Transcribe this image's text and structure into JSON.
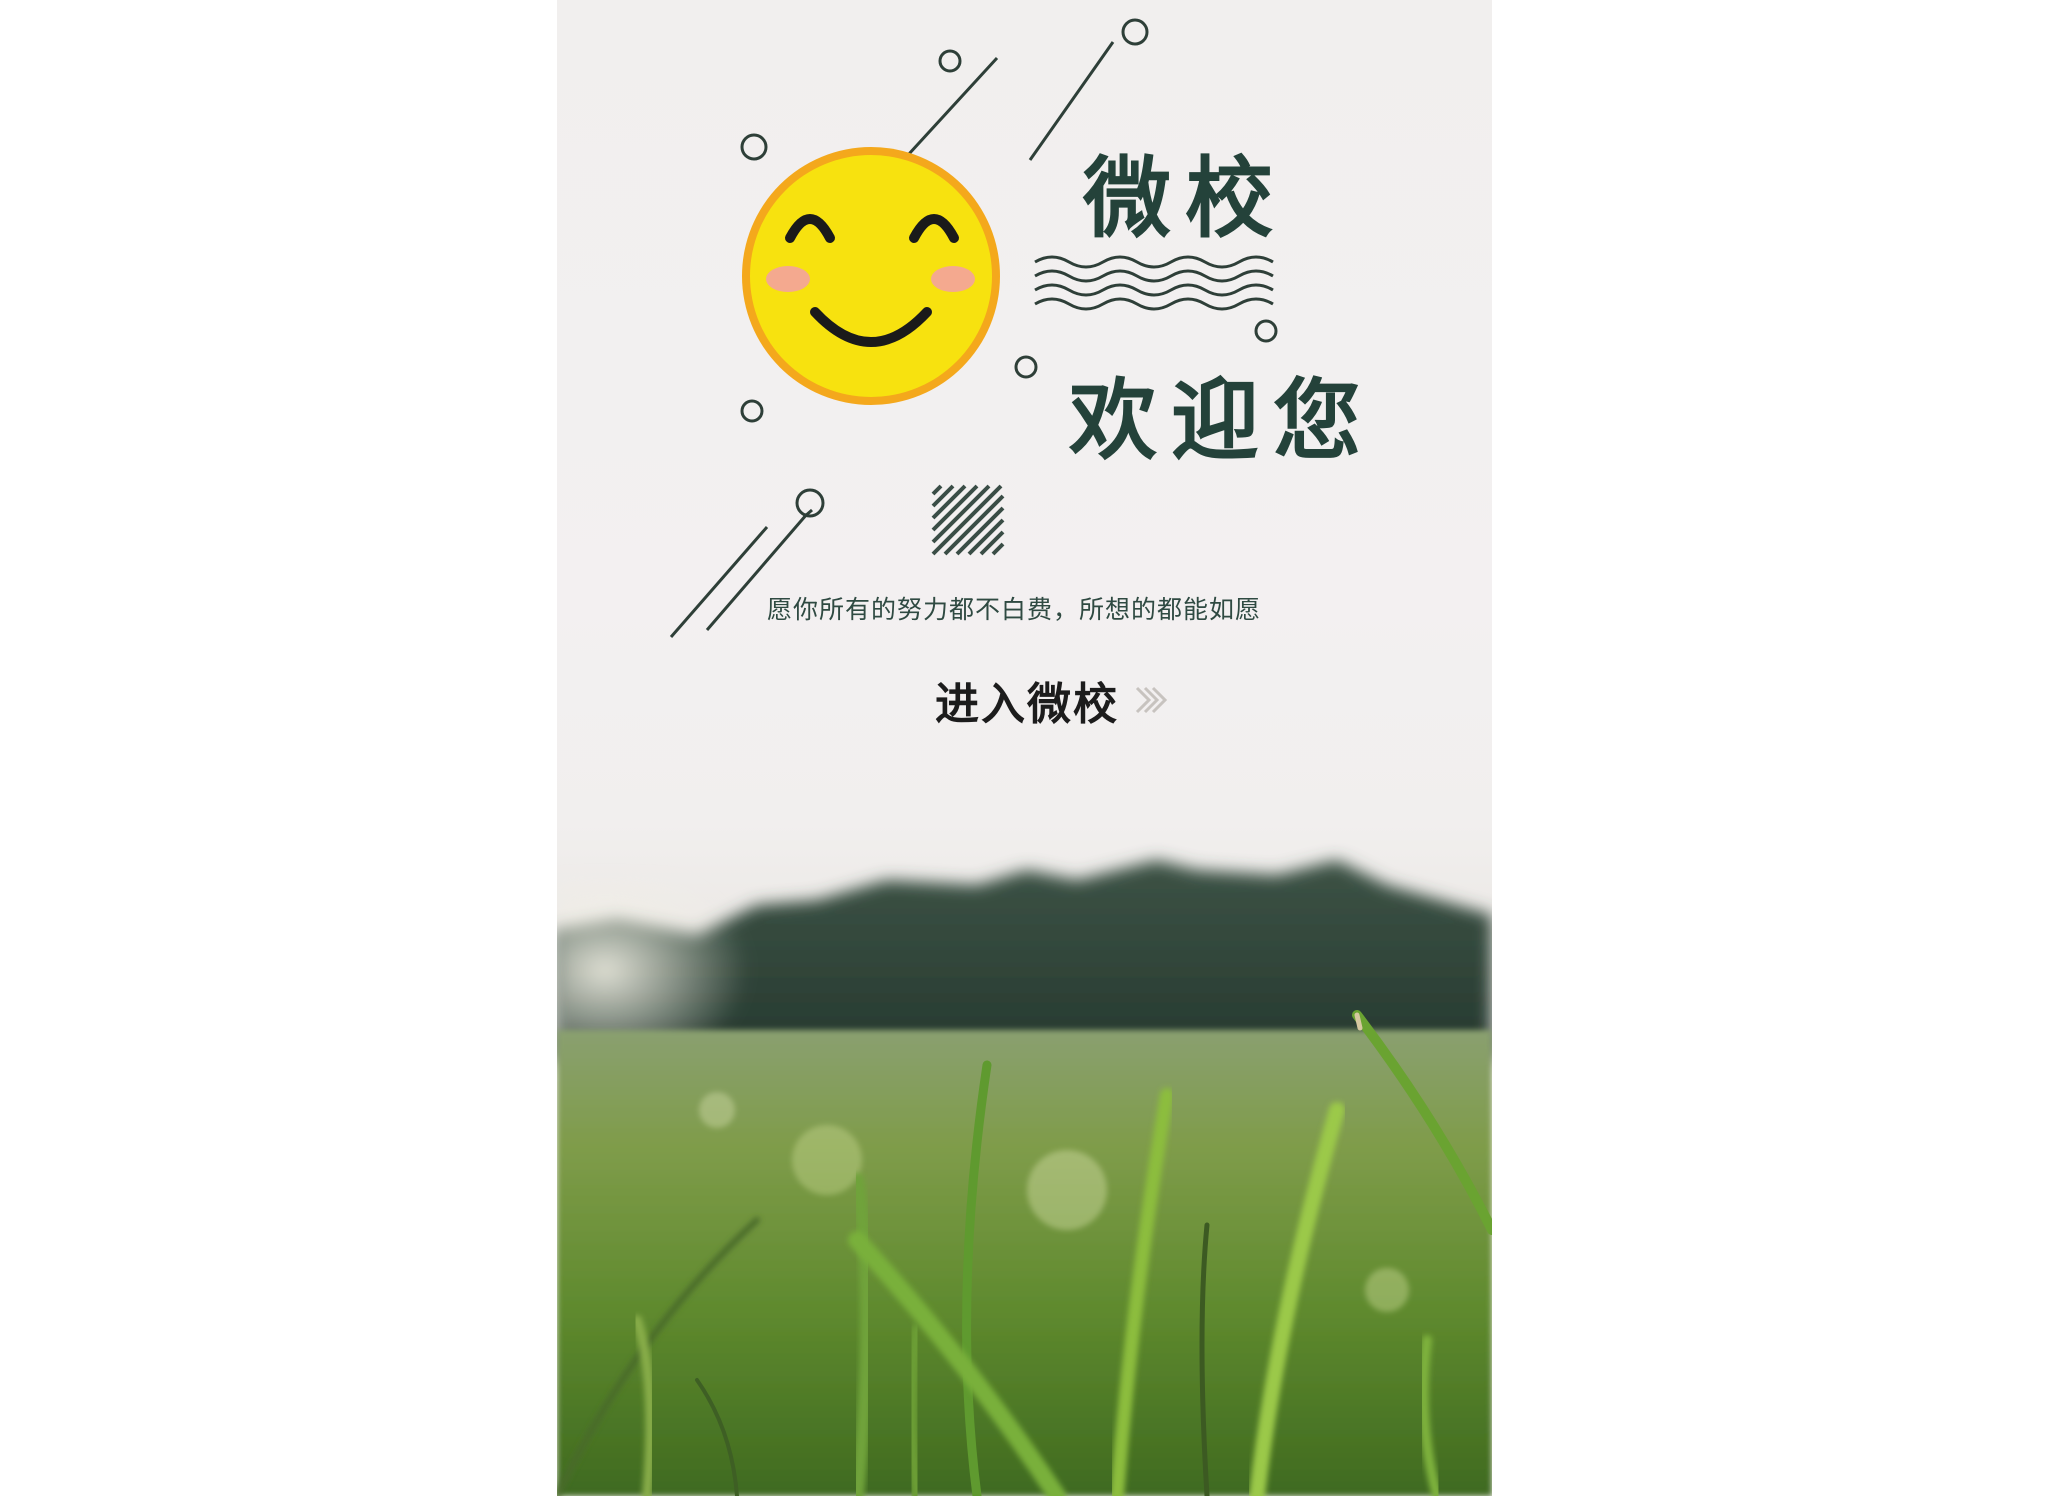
{
  "title": {
    "line1": "微校",
    "line2": "欢迎您"
  },
  "slogan": "愿你所有的努力都不白费，所想的都能如愿",
  "enter_button": {
    "label": "进入微校",
    "icon": "double-chevron-right-icon"
  },
  "mascot": {
    "icon": "smiley-face-icon",
    "face_color": "#f7e20f",
    "rim_color": "#f4a81c",
    "cheek_color": "#f4a98f"
  },
  "colors": {
    "accent_dark_green": "#24423a",
    "background_top": "#f1efee"
  }
}
